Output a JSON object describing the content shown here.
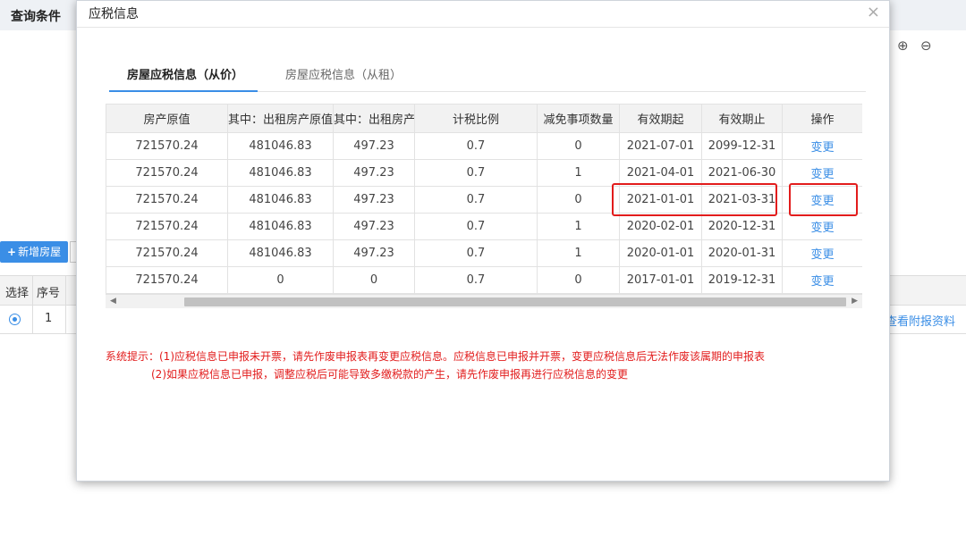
{
  "background": {
    "title": "查询条件",
    "add_button": "新增房屋",
    "grid_headers": [
      "选择",
      "序号"
    ],
    "row_number": "1",
    "right_link": "查看附报资料"
  },
  "modal": {
    "title": "应税信息",
    "close": "×",
    "tabs": [
      "房屋应税信息（从价）",
      "房屋应税信息（从租）"
    ],
    "columns": [
      "房产原值",
      "其中：出租房产原值",
      "其中：出租房产",
      "计税比例",
      "减免事项数量",
      "有效期起",
      "有效期止",
      "操作"
    ],
    "rows": [
      [
        "721570.24",
        "481046.83",
        "497.23",
        "0.7",
        "0",
        "2021-07-01",
        "2099-12-31",
        "变更"
      ],
      [
        "721570.24",
        "481046.83",
        "497.23",
        "0.7",
        "1",
        "2021-04-01",
        "2021-06-30",
        "变更"
      ],
      [
        "721570.24",
        "481046.83",
        "497.23",
        "0.7",
        "0",
        "2021-01-01",
        "2021-03-31",
        "变更"
      ],
      [
        "721570.24",
        "481046.83",
        "497.23",
        "0.7",
        "1",
        "2020-02-01",
        "2020-12-31",
        "变更"
      ],
      [
        "721570.24",
        "481046.83",
        "497.23",
        "0.7",
        "1",
        "2020-01-01",
        "2020-01-31",
        "变更"
      ],
      [
        "721570.24",
        "0",
        "0",
        "0.7",
        "0",
        "2017-01-01",
        "2019-12-31",
        "变更"
      ]
    ],
    "notice_line1": "系统提示：(1)应税信息已申报未开票，请先作废申报表再变更应税信息。应税信息已申报并开票，变更应税信息后无法作废该属期的申报表",
    "notice_line2": "(2)如果应税信息已申报，调整应税后可能导致多缴税款的产生，请先作废申报再进行应税信息的变更"
  }
}
